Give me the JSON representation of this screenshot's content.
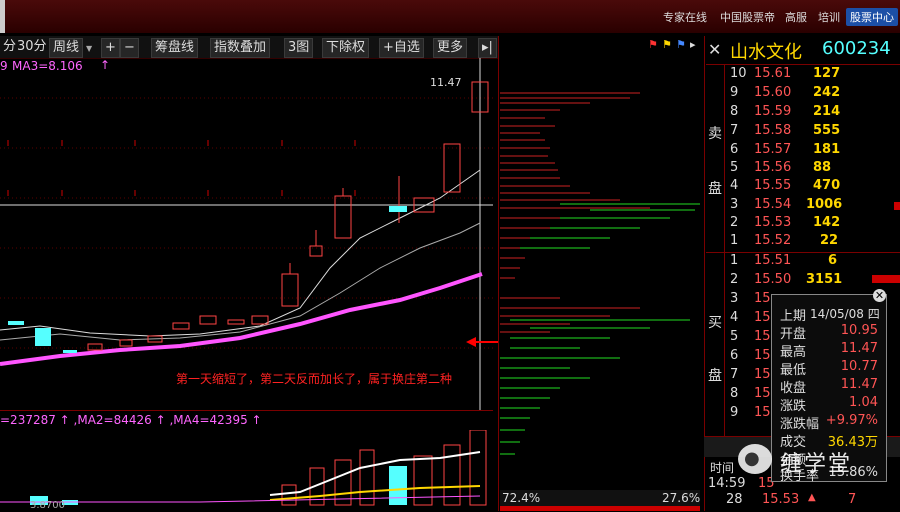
{
  "topbar": {
    "links": [
      "专家在线",
      "中国股票帝",
      "高服",
      "培训",
      "股票中心"
    ]
  },
  "toolbar": {
    "period_a": "分",
    "period_30": "30分",
    "weekly": "周线",
    "plus": "+",
    "minus": "−",
    "chips": "筹盘线",
    "overlay": "指数叠加",
    "three_chart": "3图",
    "exright": "下除权",
    "fav": "+自选",
    "more": "更多",
    "expand": "▸|"
  },
  "kline": {
    "ma_label_left": "9",
    "ma_label": "MA3=8.106",
    "high_price_label": "11.47",
    "annotation": "第一天缩短了，第二天反而加长了，属于换庄第二种"
  },
  "volume": {
    "indicator": "=237287 ↑ ,MA2=84426 ↑ ,MA4=42395 ↑",
    "bottom_label": "3.8700"
  },
  "chips": {
    "left_pct": "72.4%",
    "right_pct": "27.6%"
  },
  "stock": {
    "name": "山水文化",
    "code": "600234",
    "sell_label_1": "卖",
    "sell_label_2": "盘",
    "buy_label_1": "买",
    "buy_label_2": "盘"
  },
  "orderbook": {
    "asks": [
      {
        "idx": "10",
        "price": "15.61",
        "vol": "127"
      },
      {
        "idx": "9",
        "price": "15.60",
        "vol": "242"
      },
      {
        "idx": "8",
        "price": "15.59",
        "vol": "214"
      },
      {
        "idx": "7",
        "price": "15.58",
        "vol": "555"
      },
      {
        "idx": "6",
        "price": "15.57",
        "vol": "181"
      },
      {
        "idx": "5",
        "price": "15.56",
        "vol": "88"
      },
      {
        "idx": "4",
        "price": "15.55",
        "vol": "470"
      },
      {
        "idx": "3",
        "price": "15.54",
        "vol": "1006"
      },
      {
        "idx": "2",
        "price": "15.53",
        "vol": "142"
      },
      {
        "idx": "1",
        "price": "15.52",
        "vol": "22"
      }
    ],
    "bids": [
      {
        "idx": "1",
        "price": "15.51",
        "vol": "6"
      },
      {
        "idx": "2",
        "price": "15.50",
        "vol": "3151"
      },
      {
        "idx": "3",
        "price": "15",
        "vol": ""
      },
      {
        "idx": "4",
        "price": "15",
        "vol": ""
      },
      {
        "idx": "5",
        "price": "15",
        "vol": ""
      },
      {
        "idx": "6",
        "price": "15",
        "vol": ""
      },
      {
        "idx": "7",
        "price": "15",
        "vol": ""
      },
      {
        "idx": "8",
        "price": "15",
        "vol": ""
      },
      {
        "idx": "9",
        "price": "15",
        "vol": ""
      }
    ]
  },
  "popup": {
    "rows": [
      {
        "label": "上期",
        "value": "14/05/08 四",
        "color": "#ddd"
      },
      {
        "label": "开盘",
        "value": "10.95",
        "color": "#ff5555"
      },
      {
        "label": "最高",
        "value": "11.47",
        "color": "#ff5555"
      },
      {
        "label": "最低",
        "value": "10.77",
        "color": "#ff5555"
      },
      {
        "label": "收盘",
        "value": "11.47",
        "color": "#ff5555"
      },
      {
        "label": "涨跌",
        "value": "1.04",
        "color": "#ff5555"
      },
      {
        "label": "涨跌幅",
        "value": "+9.97%",
        "color": "#ff5555"
      },
      {
        "label": "成交",
        "value": "36.43万",
        "color": "#ffd700"
      },
      {
        "label": "金额",
        "value": "",
        "color": "#ddd"
      },
      {
        "label": "换手率",
        "value": "13.86%",
        "color": "#ddd"
      }
    ],
    "close": "✕"
  },
  "ticks": {
    "header": "时间",
    "rows": [
      {
        "time": "14:59",
        "price": "15",
        "vol": "",
        "dir": ""
      },
      {
        "time": "28",
        "price": "15.53",
        "vol": "7",
        "dir": "▲"
      }
    ]
  },
  "watermark": "缠学堂"
}
